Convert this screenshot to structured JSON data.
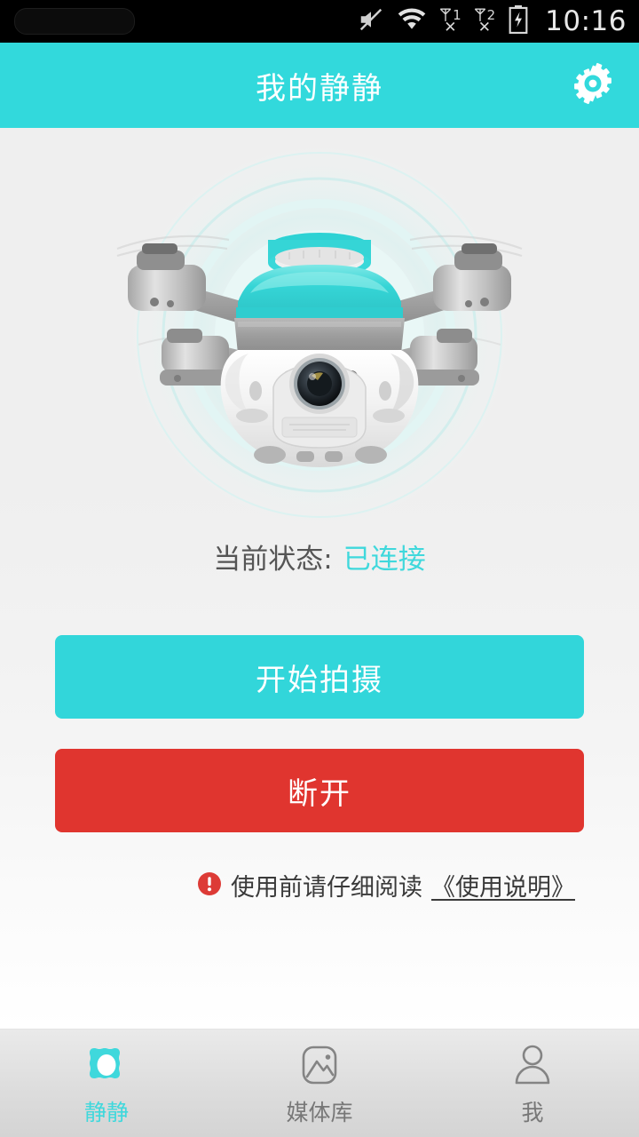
{
  "statusbar": {
    "time": "10:16",
    "icons": [
      "mute-icon",
      "wifi-icon",
      "sim1-no-signal-icon",
      "sim2-no-signal-icon",
      "battery-charging-icon"
    ],
    "sim1_label": "1",
    "sim2_label": "2",
    "sim_no_signal_mark": "✕"
  },
  "header": {
    "title": "我的静静",
    "settings_icon": "gear-icon",
    "background_color": "#32d9dc"
  },
  "main": {
    "illustration": "drone-image",
    "status_label": "当前状态:",
    "status_value": "已连接",
    "status_value_color": "#3fd8dc",
    "record_button": "开始拍摄",
    "record_button_color": "#32d6da",
    "disconnect_button": "断开",
    "disconnect_button_color": "#e0352f",
    "warning_icon": "alert-circle-icon",
    "warning_icon_color": "#dd3b36",
    "warning_text": "使用前请仔细阅读",
    "warning_link": "《使用说明》"
  },
  "tabbar": {
    "active_index": 0,
    "active_color": "#3fd8dc",
    "items": [
      {
        "label": "静静",
        "icon": "drone-camera-icon"
      },
      {
        "label": "媒体库",
        "icon": "photo-library-icon"
      },
      {
        "label": "我",
        "icon": "person-icon"
      }
    ]
  }
}
